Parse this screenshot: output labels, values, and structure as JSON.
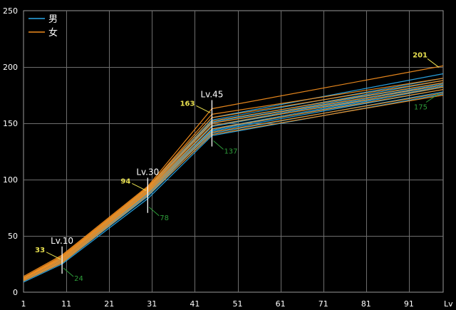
{
  "chart_data": {
    "type": "line",
    "xlabel": "Lv",
    "ylabel": "",
    "xlim": [
      1,
      99
    ],
    "ylim": [
      0,
      250
    ],
    "x_ticks": [
      1,
      11,
      21,
      31,
      41,
      51,
      61,
      71,
      81,
      91
    ],
    "y_ticks": [
      0,
      50,
      100,
      150,
      200,
      250
    ],
    "grid": true,
    "legend_position": "top-left",
    "legend": [
      {
        "label": "男",
        "color": "#2aa8e8"
      },
      {
        "label": "女",
        "color": "#f08c1e"
      }
    ],
    "colors": {
      "male": "#2aa8e8",
      "female": "#f08c1e",
      "grid": "#6e6e6e",
      "axis_text": "#ffffff",
      "annotation_max": "#e8e050",
      "annotation_min": "#2e9e3a"
    },
    "series": [
      {
        "group": "male",
        "x": [
          1,
          10,
          30,
          45,
          99
        ],
        "y": [
          9,
          25,
          83,
          139,
          176
        ]
      },
      {
        "group": "male",
        "x": [
          1,
          10,
          30,
          45,
          99
        ],
        "y": [
          10,
          26,
          85,
          141,
          178
        ]
      },
      {
        "group": "male",
        "x": [
          1,
          10,
          30,
          45,
          99
        ],
        "y": [
          10,
          27,
          86,
          143,
          180
        ]
      },
      {
        "group": "male",
        "x": [
          1,
          10,
          30,
          45,
          99
        ],
        "y": [
          11,
          27,
          87,
          144,
          182
        ]
      },
      {
        "group": "male",
        "x": [
          1,
          10,
          30,
          45,
          99
        ],
        "y": [
          11,
          28,
          88,
          145,
          183
        ]
      },
      {
        "group": "male",
        "x": [
          1,
          10,
          30,
          45,
          99
        ],
        "y": [
          11,
          28,
          89,
          147,
          184
        ]
      },
      {
        "group": "male",
        "x": [
          1,
          10,
          30,
          45,
          99
        ],
        "y": [
          12,
          29,
          90,
          148,
          185
        ]
      },
      {
        "group": "male",
        "x": [
          1,
          10,
          30,
          45,
          99
        ],
        "y": [
          12,
          29,
          91,
          150,
          186
        ]
      },
      {
        "group": "male",
        "x": [
          1,
          10,
          30,
          45,
          99
        ],
        "y": [
          12,
          30,
          92,
          151,
          188
        ]
      },
      {
        "group": "male",
        "x": [
          1,
          10,
          30,
          45,
          99
        ],
        "y": [
          13,
          30,
          92,
          153,
          190
        ]
      },
      {
        "group": "male",
        "x": [
          1,
          10,
          30,
          45,
          99
        ],
        "y": [
          13,
          31,
          93,
          155,
          194
        ]
      },
      {
        "group": "female",
        "x": [
          1,
          10,
          30,
          45,
          99
        ],
        "y": [
          10,
          26,
          86,
          140,
          175
        ]
      },
      {
        "group": "female",
        "x": [
          1,
          10,
          30,
          45,
          99
        ],
        "y": [
          11,
          27,
          88,
          142,
          177
        ]
      },
      {
        "group": "female",
        "x": [
          1,
          10,
          30,
          45,
          99
        ],
        "y": [
          11,
          28,
          89,
          145,
          180
        ]
      },
      {
        "group": "female",
        "x": [
          1,
          10,
          30,
          45,
          99
        ],
        "y": [
          12,
          29,
          90,
          148,
          182
        ]
      },
      {
        "group": "female",
        "x": [
          1,
          10,
          30,
          45,
          99
        ],
        "y": [
          12,
          30,
          91,
          150,
          184
        ]
      },
      {
        "group": "female",
        "x": [
          1,
          10,
          30,
          45,
          99
        ],
        "y": [
          12,
          31,
          92,
          152,
          186
        ]
      },
      {
        "group": "female",
        "x": [
          1,
          10,
          30,
          45,
          99
        ],
        "y": [
          13,
          31,
          93,
          155,
          188
        ]
      },
      {
        "group": "female",
        "x": [
          1,
          10,
          30,
          45,
          99
        ],
        "y": [
          13,
          32,
          93,
          158,
          190
        ]
      },
      {
        "group": "female",
        "x": [
          1,
          10,
          30,
          45,
          99
        ],
        "y": [
          14,
          33,
          94,
          163,
          201
        ]
      }
    ],
    "markers": [
      {
        "x": 10,
        "label": "Lv.10",
        "max": {
          "label": "33",
          "y": 33
        },
        "min": {
          "label": "24",
          "y": 24
        }
      },
      {
        "x": 30,
        "label": "Lv.30",
        "max": {
          "label": "94",
          "y": 94
        },
        "min": {
          "label": "78",
          "y": 78
        }
      },
      {
        "x": 45,
        "label": "Lv.45",
        "max": {
          "label": "163",
          "y": 163
        },
        "min": {
          "label": "137",
          "y": 137
        }
      }
    ],
    "end_annotations": [
      {
        "label": "201",
        "y": 201,
        "kind": "max"
      },
      {
        "label": "175",
        "y": 175,
        "kind": "min"
      }
    ]
  }
}
